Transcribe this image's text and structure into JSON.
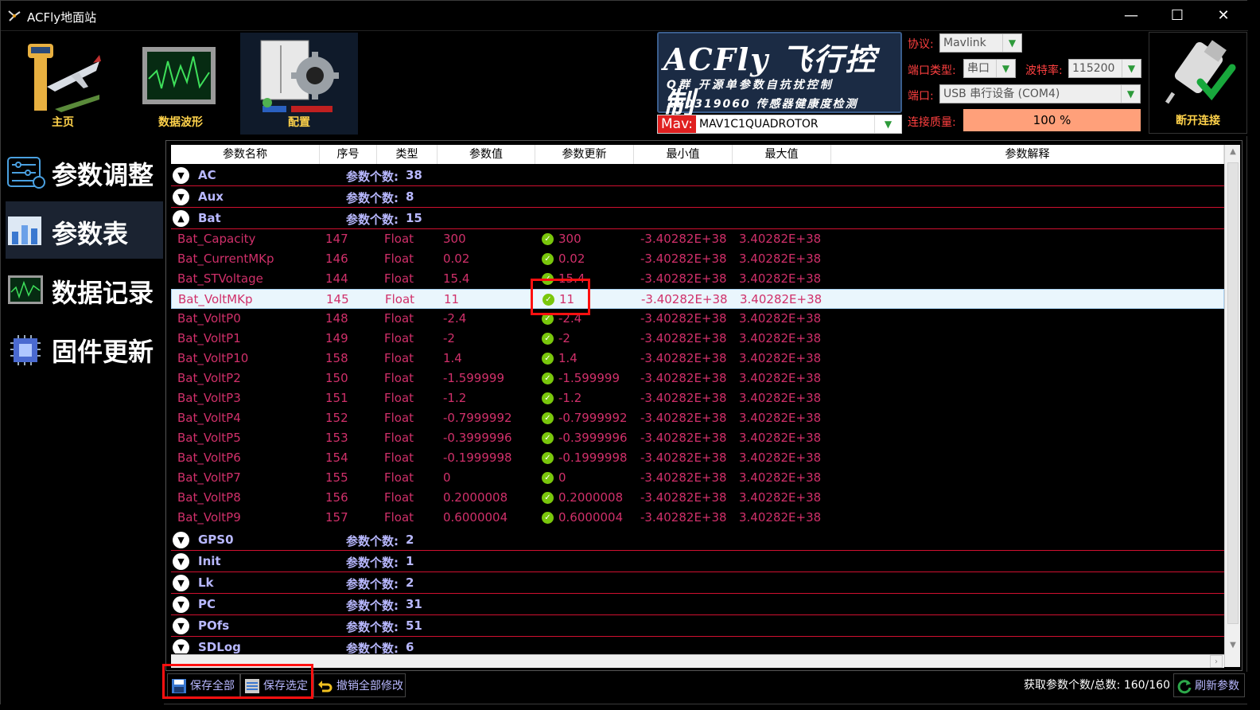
{
  "window": {
    "title": "ACFly地面站",
    "min": "—",
    "max": "☐",
    "close": "✕"
  },
  "toolbar": {
    "home": "主页",
    "waveform": "数据波形",
    "config": "配置"
  },
  "logo": {
    "big": "ACFly 飞行控制",
    "line2": "Q群  开源单参数自抗扰控制",
    "line3": "180319060 传感器健康度检测"
  },
  "connection": {
    "protocol_label": "协议:",
    "protocol_value": "Mavlink",
    "port_type_label": "端口类型:",
    "port_type_value": "串口",
    "baud_label": "波特率:",
    "baud_value": "115200",
    "port_label": "端口:",
    "port_value": "USB 串行设备 (COM4)",
    "mav_label": "Mav:",
    "mav_value": "MAV1C1QUADROTOR",
    "quality_label": "连接质量:",
    "quality_value": "100   %",
    "disconnect_label": "断开连接"
  },
  "sidebar": {
    "items": [
      "参数调整",
      "参数表",
      "数据记录",
      "固件更新"
    ],
    "active": 1
  },
  "table": {
    "headers": [
      "参数名称",
      "序号",
      "类型",
      "参数值",
      "参数更新",
      "最小值",
      "最大值",
      "参数解释"
    ],
    "count_label": "参数个数:",
    "groups_top": [
      {
        "name": "AC",
        "count": "38"
      },
      {
        "name": "Aux",
        "count": "8"
      }
    ],
    "open_group": {
      "name": "Bat",
      "count": "15"
    },
    "rows": [
      {
        "name": "Bat_Capacity",
        "id": "147",
        "type": "Float",
        "value": "300",
        "update": "300",
        "min": "-3.40282E+38",
        "max": "3.40282E+38"
      },
      {
        "name": "Bat_CurrentMKp",
        "id": "146",
        "type": "Float",
        "value": "0.02",
        "update": "0.02",
        "min": "-3.40282E+38",
        "max": "3.40282E+38"
      },
      {
        "name": "Bat_STVoltage",
        "id": "144",
        "type": "Float",
        "value": "15.4",
        "update": "15.4",
        "min": "-3.40282E+38",
        "max": "3.40282E+38"
      },
      {
        "name": "Bat_VoltMKp",
        "id": "145",
        "type": "Float",
        "value": "11",
        "update": "11",
        "min": "-3.40282E+38",
        "max": "3.40282E+38",
        "selected": true
      },
      {
        "name": "Bat_VoltP0",
        "id": "148",
        "type": "Float",
        "value": "-2.4",
        "update": "-2.4",
        "min": "-3.40282E+38",
        "max": "3.40282E+38"
      },
      {
        "name": "Bat_VoltP1",
        "id": "149",
        "type": "Float",
        "value": "-2",
        "update": "-2",
        "min": "-3.40282E+38",
        "max": "3.40282E+38"
      },
      {
        "name": "Bat_VoltP10",
        "id": "158",
        "type": "Float",
        "value": "1.4",
        "update": "1.4",
        "min": "-3.40282E+38",
        "max": "3.40282E+38"
      },
      {
        "name": "Bat_VoltP2",
        "id": "150",
        "type": "Float",
        "value": "-1.599999",
        "update": "-1.599999",
        "min": "-3.40282E+38",
        "max": "3.40282E+38"
      },
      {
        "name": "Bat_VoltP3",
        "id": "151",
        "type": "Float",
        "value": "-1.2",
        "update": "-1.2",
        "min": "-3.40282E+38",
        "max": "3.40282E+38"
      },
      {
        "name": "Bat_VoltP4",
        "id": "152",
        "type": "Float",
        "value": "-0.7999992",
        "update": "-0.7999992",
        "min": "-3.40282E+38",
        "max": "3.40282E+38"
      },
      {
        "name": "Bat_VoltP5",
        "id": "153",
        "type": "Float",
        "value": "-0.3999996",
        "update": "-0.3999996",
        "min": "-3.40282E+38",
        "max": "3.40282E+38"
      },
      {
        "name": "Bat_VoltP6",
        "id": "154",
        "type": "Float",
        "value": "-0.1999998",
        "update": "-0.1999998",
        "min": "-3.40282E+38",
        "max": "3.40282E+38"
      },
      {
        "name": "Bat_VoltP7",
        "id": "155",
        "type": "Float",
        "value": "0",
        "update": "0",
        "min": "-3.40282E+38",
        "max": "3.40282E+38"
      },
      {
        "name": "Bat_VoltP8",
        "id": "156",
        "type": "Float",
        "value": "0.2000008",
        "update": "0.2000008",
        "min": "-3.40282E+38",
        "max": "3.40282E+38"
      },
      {
        "name": "Bat_VoltP9",
        "id": "157",
        "type": "Float",
        "value": "0.6000004",
        "update": "0.6000004",
        "min": "-3.40282E+38",
        "max": "3.40282E+38"
      }
    ],
    "groups_bottom": [
      {
        "name": "GPS0",
        "count": "2"
      },
      {
        "name": "Init",
        "count": "1"
      },
      {
        "name": "Lk",
        "count": "2"
      },
      {
        "name": "PC",
        "count": "31"
      },
      {
        "name": "POfs",
        "count": "51"
      },
      {
        "name": "SDLog",
        "count": "6"
      }
    ]
  },
  "bottom": {
    "save_all": "保存全部",
    "save_selected": "保存选定",
    "undo_all": "撤销全部修改",
    "status": "获取参数个数/总数:  160/160",
    "refresh": "刷新参数"
  },
  "colors": {
    "param_text": "#d0306a",
    "group_text": "#b8b8ff",
    "toolbar_label": "#ffd24a",
    "separator": "#d01030",
    "quality": "#ffa07a",
    "highlight": "#ff1010"
  }
}
